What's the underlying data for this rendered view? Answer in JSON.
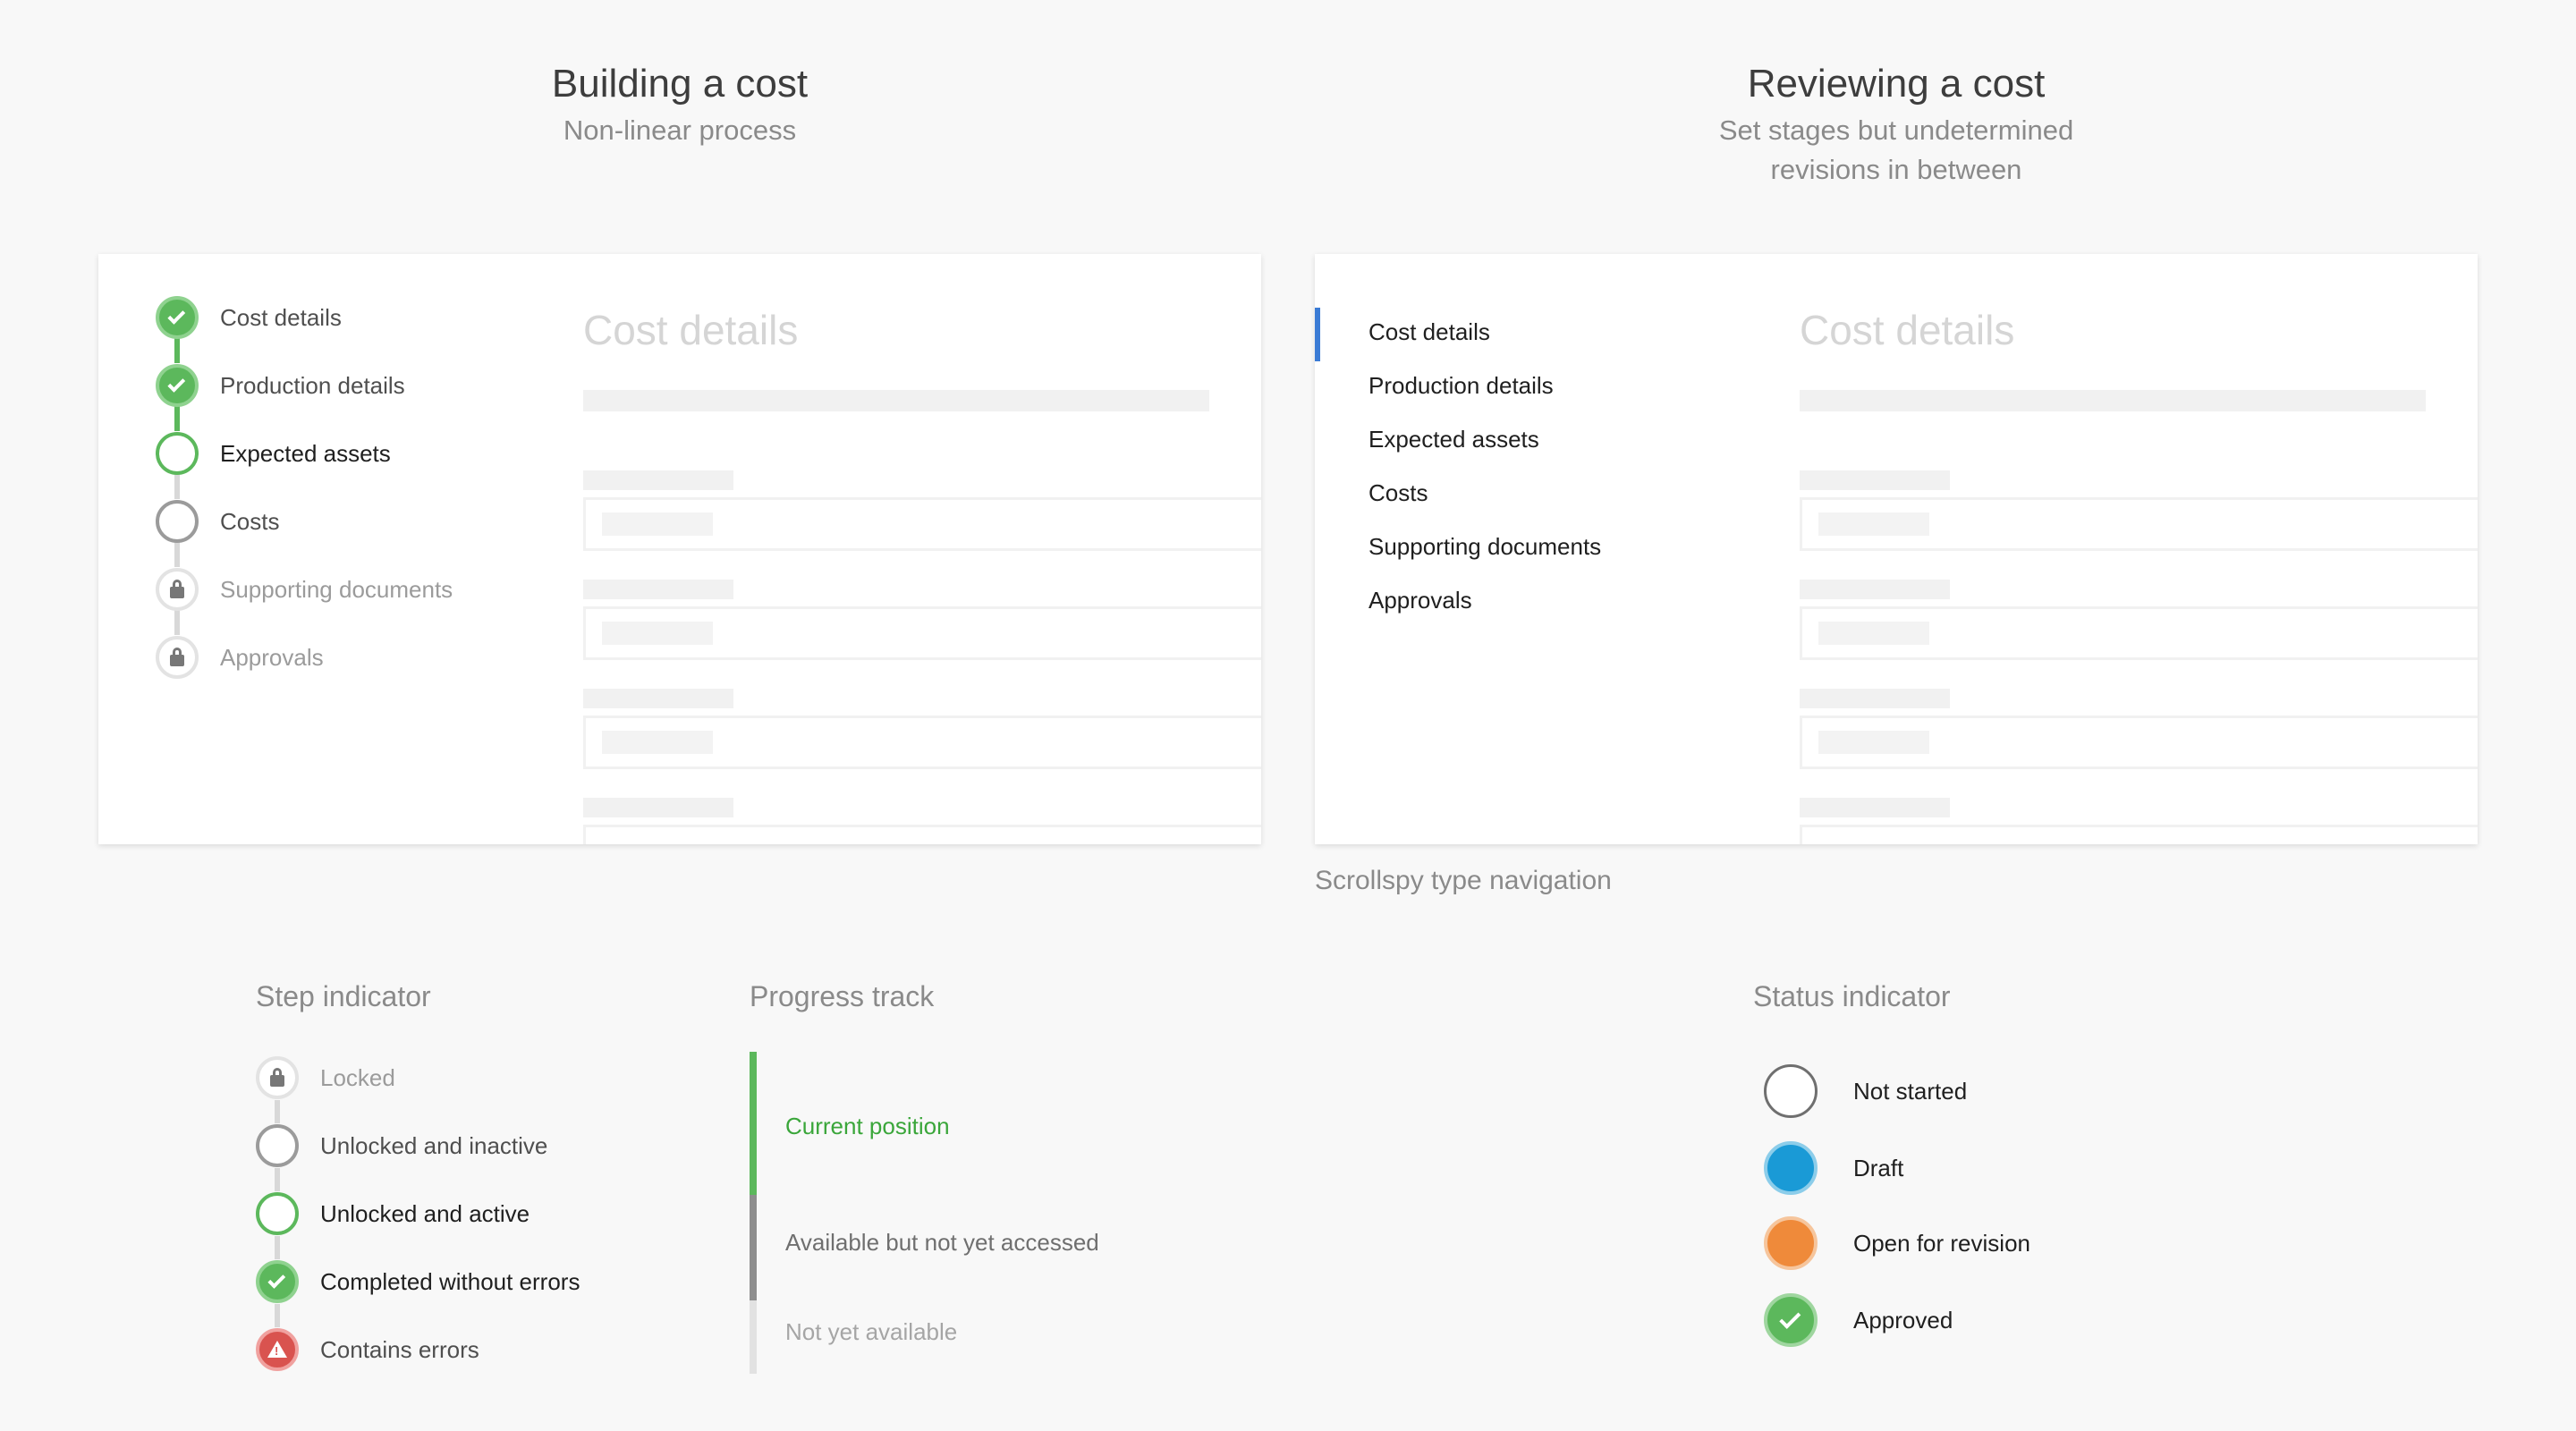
{
  "left_heading": {
    "title": "Building a cost",
    "subtitle": "Non-linear process"
  },
  "right_heading": {
    "title": "Reviewing a cost",
    "subtitle_line1": "Set stages but undetermined",
    "subtitle_line2": "revisions in between"
  },
  "left_card": {
    "steps": [
      {
        "label": "Cost details",
        "state": "completed"
      },
      {
        "label": "Production details",
        "state": "completed"
      },
      {
        "label": "Expected assets",
        "state": "active"
      },
      {
        "label": "Costs",
        "state": "inactive"
      },
      {
        "label": "Supporting documents",
        "state": "locked"
      },
      {
        "label": "Approvals",
        "state": "locked"
      }
    ],
    "content_title": "Cost details"
  },
  "right_card": {
    "nav": [
      "Cost details",
      "Production details",
      "Expected assets",
      "Costs",
      "Supporting documents",
      "Approvals"
    ],
    "content_title": "Cost details"
  },
  "scrollspy_caption": "Scrollspy type navigation",
  "step_indicator": {
    "title": "Step indicator",
    "items": [
      "Locked",
      "Unlocked and inactive",
      "Unlocked and active",
      "Completed without errors",
      "Contains errors"
    ]
  },
  "progress_track": {
    "title": "Progress track",
    "current": "Current position",
    "available": "Available but not yet accessed",
    "unavailable": "Not yet available"
  },
  "status_indicator": {
    "title": "Status indicator",
    "items": [
      "Not started",
      "Draft",
      "Open for revision",
      "Approved"
    ]
  },
  "colors": {
    "green": "#5cb85c",
    "blue": "#1a9ad6",
    "orange": "#ef8a3a",
    "red": "#d9534f",
    "nav_accent": "#3a7bd5"
  }
}
